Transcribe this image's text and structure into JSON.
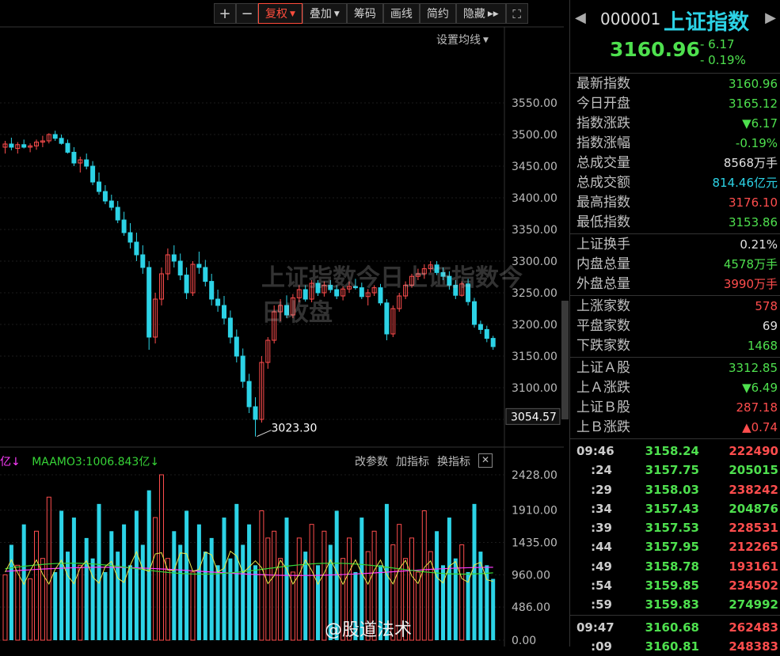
{
  "toolbar": {
    "plus": "+",
    "minus": "−",
    "fuquan": "复权",
    "diejia": "叠加",
    "chouma": "筹码",
    "huaxian": "画线",
    "jianyue": "简约",
    "yincang": "隐藏",
    "fullscreen": "⛶"
  },
  "ma_setting": "设置均线",
  "volume_legend": {
    "ma2_fragment": "亿↓",
    "ma3": "MAAMO3:1006.843亿↓"
  },
  "volume_tools": [
    "改参数",
    "加指标",
    "换指标"
  ],
  "watermark": "上证指数今日上证指数今日收盘",
  "weibo": "@股道法术",
  "colors": {
    "up": "#ff4d4d",
    "down": "#2cd3e6",
    "green": "#4ee04e",
    "bg": "#000000"
  },
  "chart_data": {
    "type": "candlestick",
    "price_axis": {
      "ticks": [
        3550,
        3500,
        3450,
        3400,
        3350,
        3300,
        3250,
        3200,
        3150,
        3100,
        3050
      ],
      "current": "3054.57"
    },
    "low_annotation": "3023.30",
    "volume_axis": {
      "ticks": [
        "2428.00",
        "1910.00",
        "1435.00",
        "960.00",
        "486.00",
        "0.00"
      ]
    },
    "candles": [
      [
        3480,
        3490,
        3470,
        3485
      ],
      [
        3485,
        3495,
        3475,
        3480
      ],
      [
        3478,
        3488,
        3470,
        3484
      ],
      [
        3484,
        3492,
        3478,
        3480
      ],
      [
        3480,
        3486,
        3472,
        3482
      ],
      [
        3482,
        3492,
        3476,
        3488
      ],
      [
        3488,
        3498,
        3480,
        3490
      ],
      [
        3490,
        3502,
        3486,
        3500
      ],
      [
        3500,
        3506,
        3490,
        3494
      ],
      [
        3494,
        3500,
        3484,
        3486
      ],
      [
        3486,
        3492,
        3470,
        3472
      ],
      [
        3472,
        3480,
        3450,
        3455
      ],
      [
        3455,
        3465,
        3440,
        3460
      ],
      [
        3460,
        3470,
        3445,
        3450
      ],
      [
        3450,
        3458,
        3420,
        3425
      ],
      [
        3425,
        3440,
        3405,
        3410
      ],
      [
        3410,
        3420,
        3390,
        3395
      ],
      [
        3395,
        3405,
        3380,
        3385
      ],
      [
        3385,
        3395,
        3360,
        3365
      ],
      [
        3365,
        3378,
        3340,
        3345
      ],
      [
        3345,
        3360,
        3320,
        3330
      ],
      [
        3330,
        3345,
        3300,
        3310
      ],
      [
        3310,
        3325,
        3280,
        3290
      ],
      [
        3290,
        3300,
        3160,
        3180
      ],
      [
        3180,
        3250,
        3170,
        3240
      ],
      [
        3240,
        3290,
        3230,
        3280
      ],
      [
        3280,
        3320,
        3270,
        3310
      ],
      [
        3310,
        3325,
        3290,
        3300
      ],
      [
        3300,
        3312,
        3270,
        3278
      ],
      [
        3278,
        3290,
        3240,
        3250
      ],
      [
        3250,
        3300,
        3245,
        3295
      ],
      [
        3295,
        3315,
        3280,
        3290
      ],
      [
        3290,
        3302,
        3260,
        3268
      ],
      [
        3268,
        3280,
        3230,
        3240
      ],
      [
        3240,
        3255,
        3220,
        3230
      ],
      [
        3230,
        3245,
        3200,
        3210
      ],
      [
        3210,
        3222,
        3170,
        3180
      ],
      [
        3180,
        3192,
        3140,
        3150
      ],
      [
        3150,
        3162,
        3100,
        3110
      ],
      [
        3110,
        3122,
        3060,
        3070
      ],
      [
        3070,
        3085,
        3023,
        3050
      ],
      [
        3050,
        3150,
        3045,
        3140
      ],
      [
        3140,
        3180,
        3130,
        3175
      ],
      [
        3175,
        3230,
        3170,
        3220
      ],
      [
        3220,
        3240,
        3205,
        3230
      ],
      [
        3230,
        3246,
        3210,
        3215
      ],
      [
        3215,
        3248,
        3210,
        3242
      ],
      [
        3242,
        3262,
        3235,
        3255
      ],
      [
        3255,
        3262,
        3236,
        3240
      ],
      [
        3240,
        3270,
        3235,
        3265
      ],
      [
        3265,
        3270,
        3245,
        3250
      ],
      [
        3250,
        3268,
        3244,
        3262
      ],
      [
        3262,
        3270,
        3250,
        3255
      ],
      [
        3255,
        3262,
        3240,
        3245
      ],
      [
        3245,
        3260,
        3238,
        3256
      ],
      [
        3256,
        3268,
        3250,
        3260
      ],
      [
        3260,
        3272,
        3255,
        3258
      ],
      [
        3258,
        3266,
        3240,
        3244
      ],
      [
        3244,
        3256,
        3230,
        3250
      ],
      [
        3250,
        3262,
        3245,
        3258
      ],
      [
        3258,
        3264,
        3230,
        3234
      ],
      [
        3234,
        3240,
        3175,
        3185
      ],
      [
        3185,
        3230,
        3180,
        3225
      ],
      [
        3225,
        3250,
        3220,
        3245
      ],
      [
        3245,
        3268,
        3240,
        3262
      ],
      [
        3262,
        3280,
        3258,
        3276
      ],
      [
        3276,
        3288,
        3270,
        3280
      ],
      [
        3280,
        3295,
        3272,
        3288
      ],
      [
        3288,
        3300,
        3282,
        3294
      ],
      [
        3294,
        3300,
        3278,
        3282
      ],
      [
        3282,
        3290,
        3270,
        3276
      ],
      [
        3276,
        3284,
        3255,
        3262
      ],
      [
        3262,
        3270,
        3240,
        3246
      ],
      [
        3246,
        3268,
        3244,
        3264
      ],
      [
        3264,
        3272,
        3230,
        3236
      ],
      [
        3236,
        3242,
        3195,
        3200
      ],
      [
        3200,
        3206,
        3185,
        3192
      ],
      [
        3192,
        3198,
        3172,
        3178
      ],
      [
        3178,
        3182,
        3160,
        3165
      ]
    ],
    "volumes": [
      960,
      1400,
      1100,
      1700,
      900,
      1600,
      1200,
      2100,
      1000,
      1900,
      1300,
      1800,
      1100,
      1500,
      1200,
      2000,
      1000,
      1600,
      1300,
      1700,
      1100,
      1900,
      1400,
      2200,
      1800,
      2428,
      1200,
      1600,
      1400,
      1900,
      1000,
      1700,
      1300,
      1500,
      1100,
      1800,
      1200,
      2000,
      1400,
      1700,
      1100,
      1900,
      1500,
      1600,
      1200,
      1800,
      1000,
      1500,
      1300,
      1700,
      1100,
      1600,
      1400,
      1900,
      1200,
      1500,
      1000,
      1800,
      1300,
      1600,
      1100,
      2000,
      1400,
      1700,
      1200,
      1500,
      1000,
      1900,
      1300,
      1600,
      1100,
      1800,
      1200,
      1400,
      1000,
      2000,
      1300,
      1100,
      900
    ],
    "ma_yellow_level": 1000,
    "ma_green_level": 1050
  },
  "panel": {
    "code": "000001",
    "name": "上证指数",
    "price": "3160.96",
    "chg": "- 6.17",
    "chg_pct": "- 0.19%",
    "groups": [
      [
        {
          "label": "最新指数",
          "value": "3160.96",
          "color": "green"
        },
        {
          "label": "今日开盘",
          "value": "3165.12",
          "color": "green"
        },
        {
          "label": "指数涨跌",
          "value": "▼6.17",
          "color": "green"
        },
        {
          "label": "指数涨幅",
          "value": "-0.19%",
          "color": "green"
        },
        {
          "label": "总成交量",
          "value": "8568万手",
          "color": "white"
        },
        {
          "label": "总成交额",
          "value": "814.46亿元",
          "color": "cyan"
        },
        {
          "label": "最高指数",
          "value": "3176.10",
          "color": "red"
        },
        {
          "label": "最低指数",
          "value": "3153.86",
          "color": "green"
        }
      ],
      [
        {
          "label": "上证换手",
          "value": "0.21%",
          "color": "white"
        },
        {
          "label": "内盘总量",
          "value": "4578万手",
          "color": "green"
        },
        {
          "label": "外盘总量",
          "value": "3990万手",
          "color": "red"
        }
      ],
      [
        {
          "label": "上涨家数",
          "value": "578",
          "color": "red"
        },
        {
          "label": "平盘家数",
          "value": "69",
          "color": "white"
        },
        {
          "label": "下跌家数",
          "value": "1468",
          "color": "green"
        }
      ],
      [
        {
          "label": "上证Ａ股",
          "value": "3312.85",
          "color": "green"
        },
        {
          "label": "上Ａ涨跌",
          "value": "▼6.49",
          "color": "green"
        },
        {
          "label": "上证Ｂ股",
          "value": "287.18",
          "color": "red"
        },
        {
          "label": "上Ｂ涨跌",
          "value": "▲0.74",
          "color": "red"
        }
      ]
    ],
    "ticks_a": [
      {
        "t": "09:46",
        "p": "3158.24",
        "v": "222490",
        "c": "red"
      },
      {
        "t": ":24",
        "p": "3157.75",
        "v": "205015",
        "c": "green"
      },
      {
        "t": ":29",
        "p": "3158.03",
        "v": "238242",
        "c": "red"
      },
      {
        "t": ":34",
        "p": "3157.43",
        "v": "204876",
        "c": "green"
      },
      {
        "t": ":39",
        "p": "3157.53",
        "v": "228531",
        "c": "red"
      },
      {
        "t": ":44",
        "p": "3157.95",
        "v": "212265",
        "c": "red"
      },
      {
        "t": ":49",
        "p": "3158.78",
        "v": "193161",
        "c": "red"
      },
      {
        "t": ":54",
        "p": "3159.85",
        "v": "234502",
        "c": "red"
      },
      {
        "t": ":59",
        "p": "3159.83",
        "v": "274992",
        "c": "green"
      }
    ],
    "ticks_b": [
      {
        "t": "09:47",
        "p": "3160.68",
        "v": "262483",
        "c": "red"
      },
      {
        "t": ":09",
        "p": "3160.81",
        "v": "248383",
        "c": "red"
      }
    ]
  }
}
